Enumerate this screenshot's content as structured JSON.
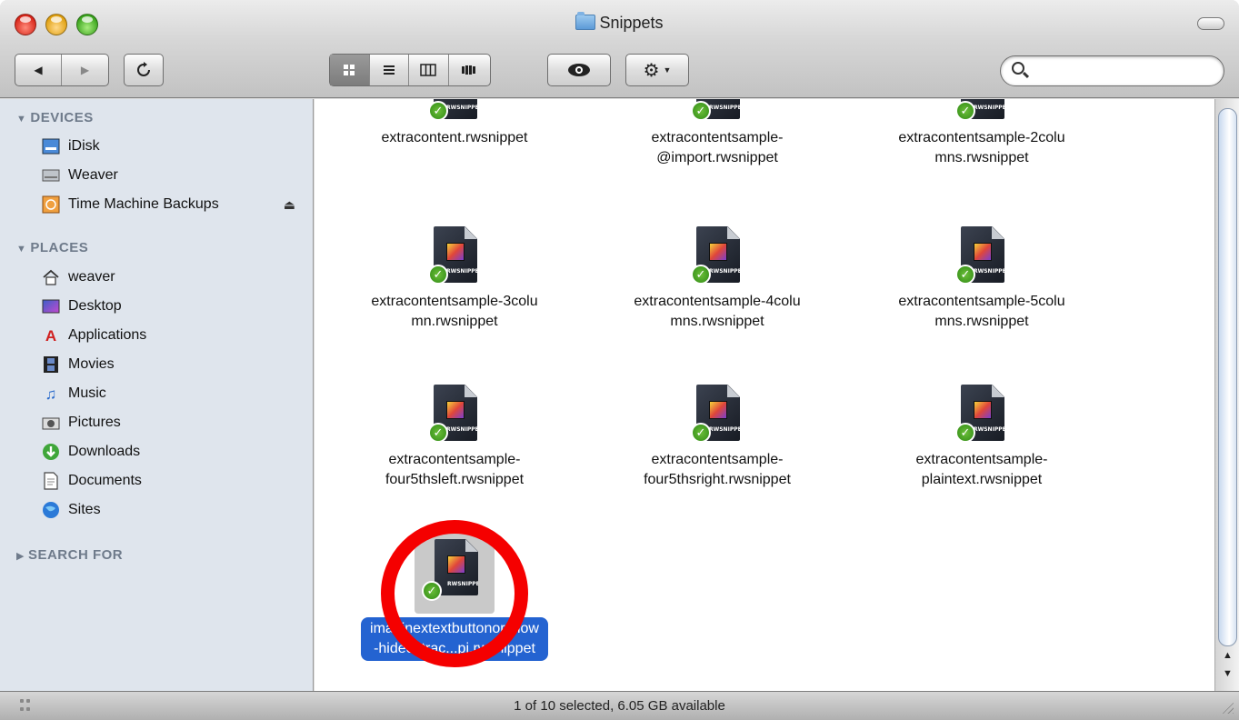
{
  "window": {
    "title": "Snippets"
  },
  "toolbar": {
    "back_icon": "◀",
    "forward_icon": "▶",
    "action_icon": "⚙",
    "search": {
      "value": "",
      "placeholder": ""
    }
  },
  "sidebar": {
    "devices_header": "DEVICES",
    "devices": [
      {
        "label": "iDisk",
        "icon": "idisk-icon"
      },
      {
        "label": "Weaver",
        "icon": "hard-drive-icon"
      },
      {
        "label": "Time Machine Backups",
        "icon": "time-machine-icon"
      }
    ],
    "places_header": "PLACES",
    "places": [
      {
        "label": "weaver",
        "icon": "home-icon"
      },
      {
        "label": "Desktop",
        "icon": "desktop-icon"
      },
      {
        "label": "Applications",
        "icon": "applications-icon"
      },
      {
        "label": "Movies",
        "icon": "movies-icon"
      },
      {
        "label": "Music",
        "icon": "music-icon"
      },
      {
        "label": "Pictures",
        "icon": "pictures-icon"
      },
      {
        "label": "Downloads",
        "icon": "downloads-icon"
      },
      {
        "label": "Documents",
        "icon": "documents-icon"
      },
      {
        "label": "Sites",
        "icon": "sites-icon"
      }
    ],
    "search_header": "SEARCH FOR"
  },
  "files": [
    {
      "name1": "extracontent.rwsnippet",
      "name2": ""
    },
    {
      "name1": "extracontentsample-",
      "name2": "@import.rwsnippet"
    },
    {
      "name1": "extracontentsample-2colu",
      "name2": "mns.rwsnippet"
    },
    {
      "name1": "extracontentsample-3colu",
      "name2": "mn.rwsnippet"
    },
    {
      "name1": "extracontentsample-4colu",
      "name2": "mns.rwsnippet"
    },
    {
      "name1": "extracontentsample-5colu",
      "name2": "mns.rwsnippet"
    },
    {
      "name1": "extracontentsample-",
      "name2": "four5thsleft.rwsnippet"
    },
    {
      "name1": "extracontentsample-",
      "name2": "four5thsright.rwsnippet"
    },
    {
      "name1": "extracontentsample-",
      "name2": "plaintext.rwsnippet"
    },
    {
      "name1": "imaginextextbuttonorshow",
      "name2": "-hideextrac...pj.rwsnippet"
    }
  ],
  "file_badge": "RWSNIPPET",
  "status": {
    "text": "1 of 10 selected, 6.05 GB available"
  },
  "colors": {
    "selection": "#2463d1",
    "annotation_circle": "#f50000",
    "sidebar_bg": "#dfe5ed"
  }
}
